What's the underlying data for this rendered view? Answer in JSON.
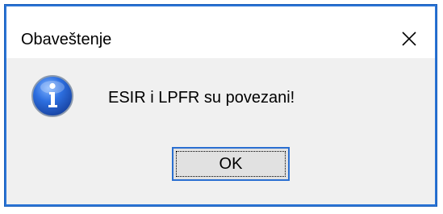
{
  "dialog": {
    "title": "Obaveštenje",
    "message": "ESIR i LPFR su povezani!",
    "ok_label": "OK",
    "close_icon": "close-icon",
    "info_icon": "info-icon"
  },
  "colors": {
    "accent": "#2a74d6",
    "dialog_background": "#f0f0f0",
    "titlebar_background": "#ffffff"
  }
}
